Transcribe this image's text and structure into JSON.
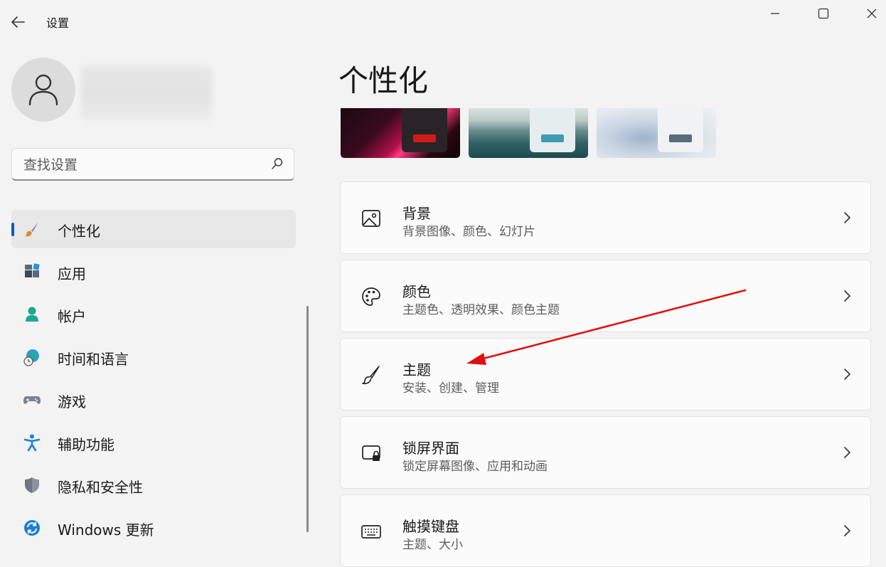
{
  "window": {
    "title": "设置"
  },
  "search": {
    "placeholder": "查找设置"
  },
  "nav": {
    "items": [
      {
        "label": "个性化",
        "icon": "paintbrush-icon",
        "active": true
      },
      {
        "label": "应用",
        "icon": "apps-icon"
      },
      {
        "label": "帐户",
        "icon": "account-icon"
      },
      {
        "label": "时间和语言",
        "icon": "globe-clock-icon"
      },
      {
        "label": "游戏",
        "icon": "gamepad-icon"
      },
      {
        "label": "辅助功能",
        "icon": "accessibility-icon"
      },
      {
        "label": "隐私和安全性",
        "icon": "shield-icon"
      },
      {
        "label": "Windows 更新",
        "icon": "update-icon"
      }
    ]
  },
  "main": {
    "title": "个性化",
    "themes": [
      {
        "name": "dark-flower-theme",
        "accent": "#d11a1a"
      },
      {
        "name": "lake-theme",
        "accent": "#3f9bb0"
      },
      {
        "name": "bloom-light-theme",
        "accent": "#5a6b7c"
      }
    ],
    "cards": [
      {
        "title": "背景",
        "subtitle": "背景图像、颜色、幻灯片",
        "icon": "image-icon"
      },
      {
        "title": "颜色",
        "subtitle": "主题色、透明效果、颜色主题",
        "icon": "palette-icon"
      },
      {
        "title": "主题",
        "subtitle": "安装、创建、管理",
        "icon": "brush-icon"
      },
      {
        "title": "锁屏界面",
        "subtitle": "锁定屏幕图像、应用和动画",
        "icon": "lock-screen-icon"
      },
      {
        "title": "触摸键盘",
        "subtitle": "主题、大小",
        "icon": "keyboard-icon"
      }
    ]
  },
  "colors": {
    "accent": "#0a5fb4",
    "annotation_arrow": "#e01010"
  }
}
